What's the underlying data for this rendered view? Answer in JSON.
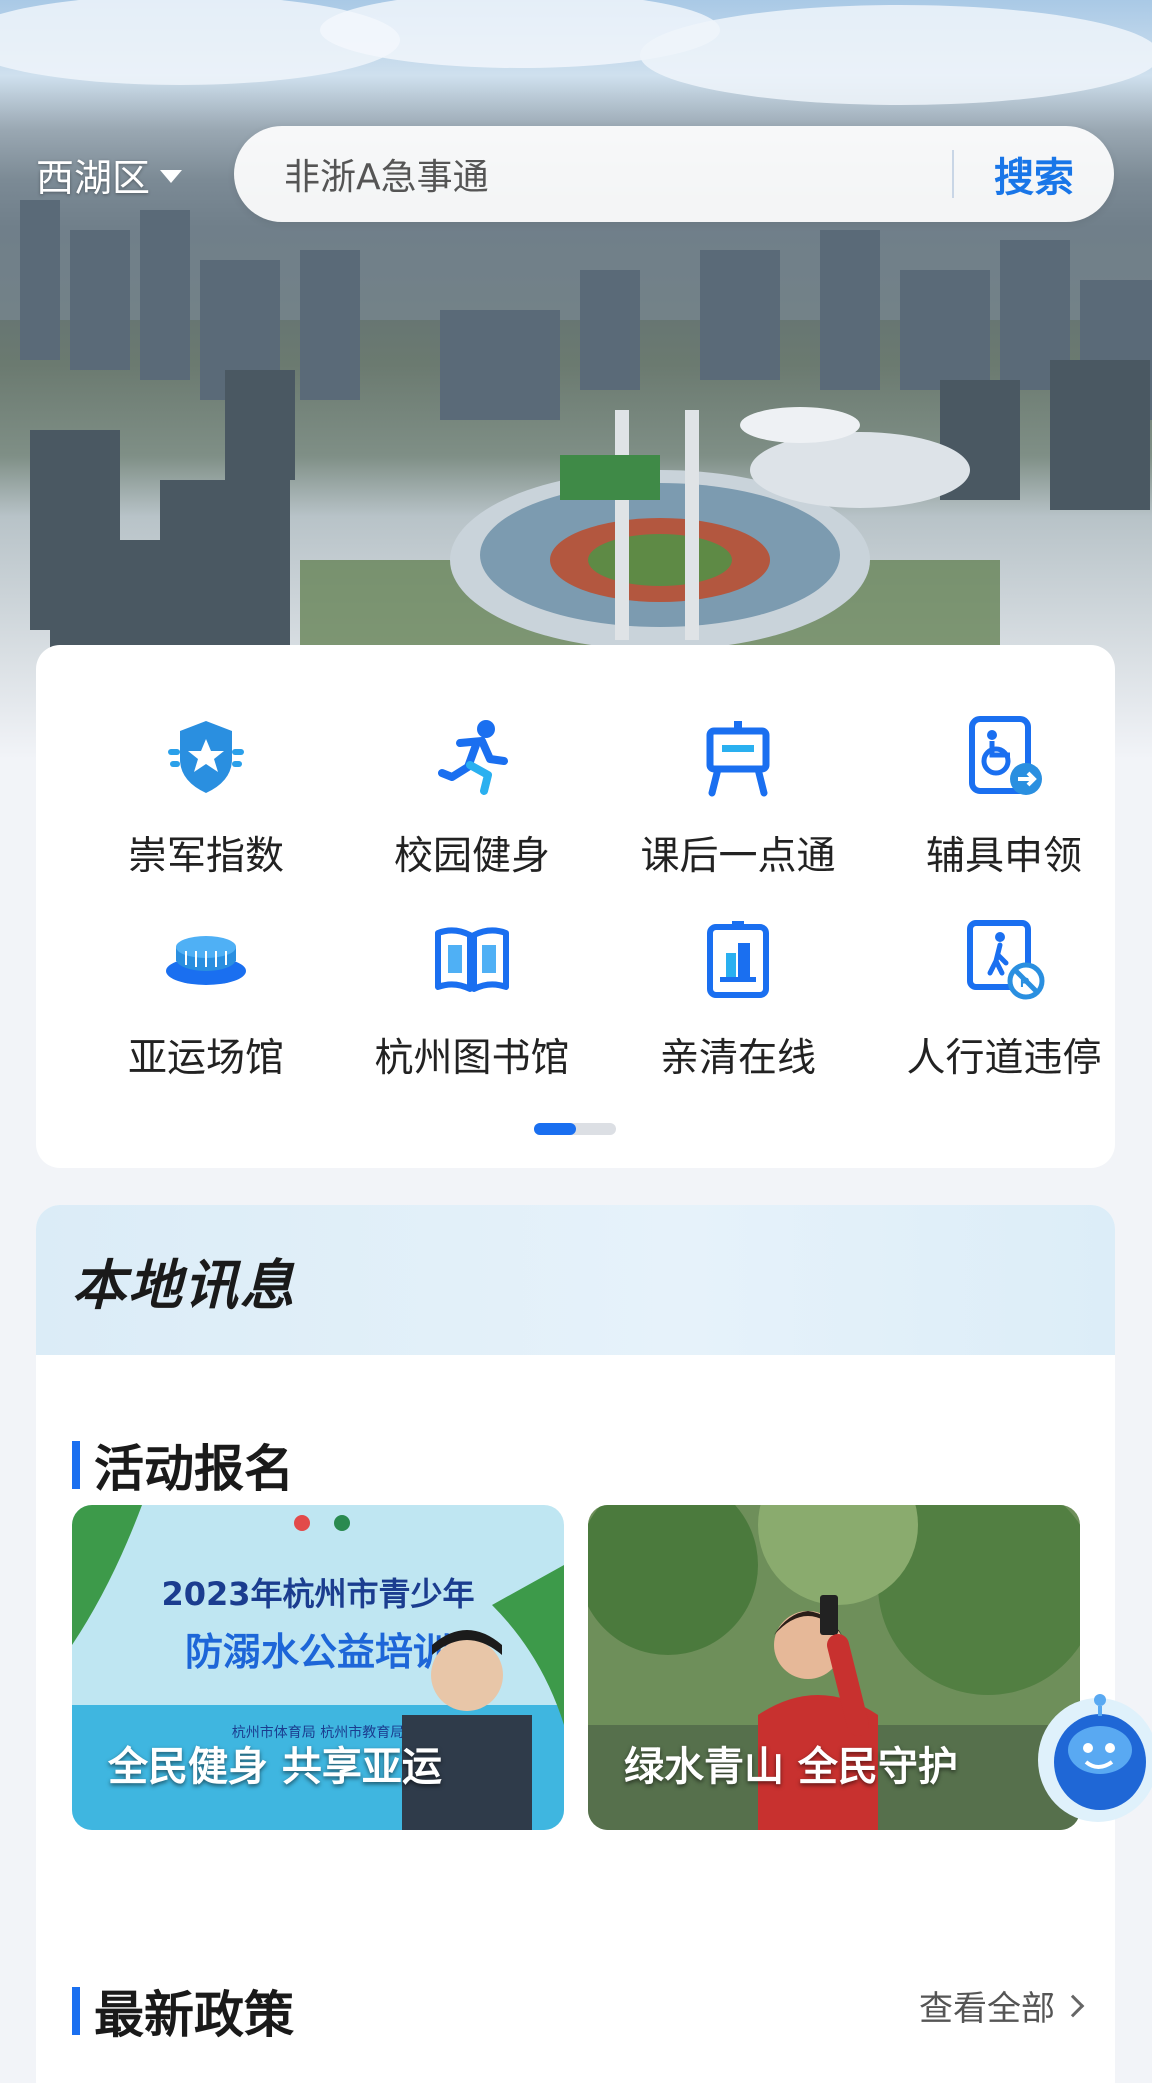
{
  "header": {
    "region": "西湖区",
    "search_placeholder": "非浙A急事通",
    "search_button": "搜索"
  },
  "services": [
    {
      "label": "崇军指数",
      "icon": "military-badge-icon"
    },
    {
      "label": "校园健身",
      "icon": "running-person-icon"
    },
    {
      "label": "课后一点通",
      "icon": "easel-board-icon"
    },
    {
      "label": "辅具申领",
      "icon": "wheelchair-document-icon"
    },
    {
      "label": "亚运场馆",
      "icon": "stadium-icon"
    },
    {
      "label": "杭州图书馆",
      "icon": "open-book-icon"
    },
    {
      "label": "亲清在线",
      "icon": "building-document-icon"
    },
    {
      "label": "人行道违停",
      "icon": "pedestrian-no-parking-icon"
    }
  ],
  "pager": {
    "page": 1,
    "total": 2
  },
  "local_news": {
    "title": "本地讯息",
    "activity_section": "活动报名",
    "activities": [
      {
        "caption": "全民健身 共享亚运",
        "poster_title": "2023年杭州市青少年",
        "poster_subtitle": "防溺水公益培训",
        "poster_org": "杭州市体育局  杭州市教育局"
      },
      {
        "caption": "绿水青山 全民守护"
      }
    ],
    "policy_section": "最新政策",
    "view_all": "查看全部"
  },
  "colors": {
    "accent": "#1a6ff0",
    "search_button": "#1976e8"
  }
}
